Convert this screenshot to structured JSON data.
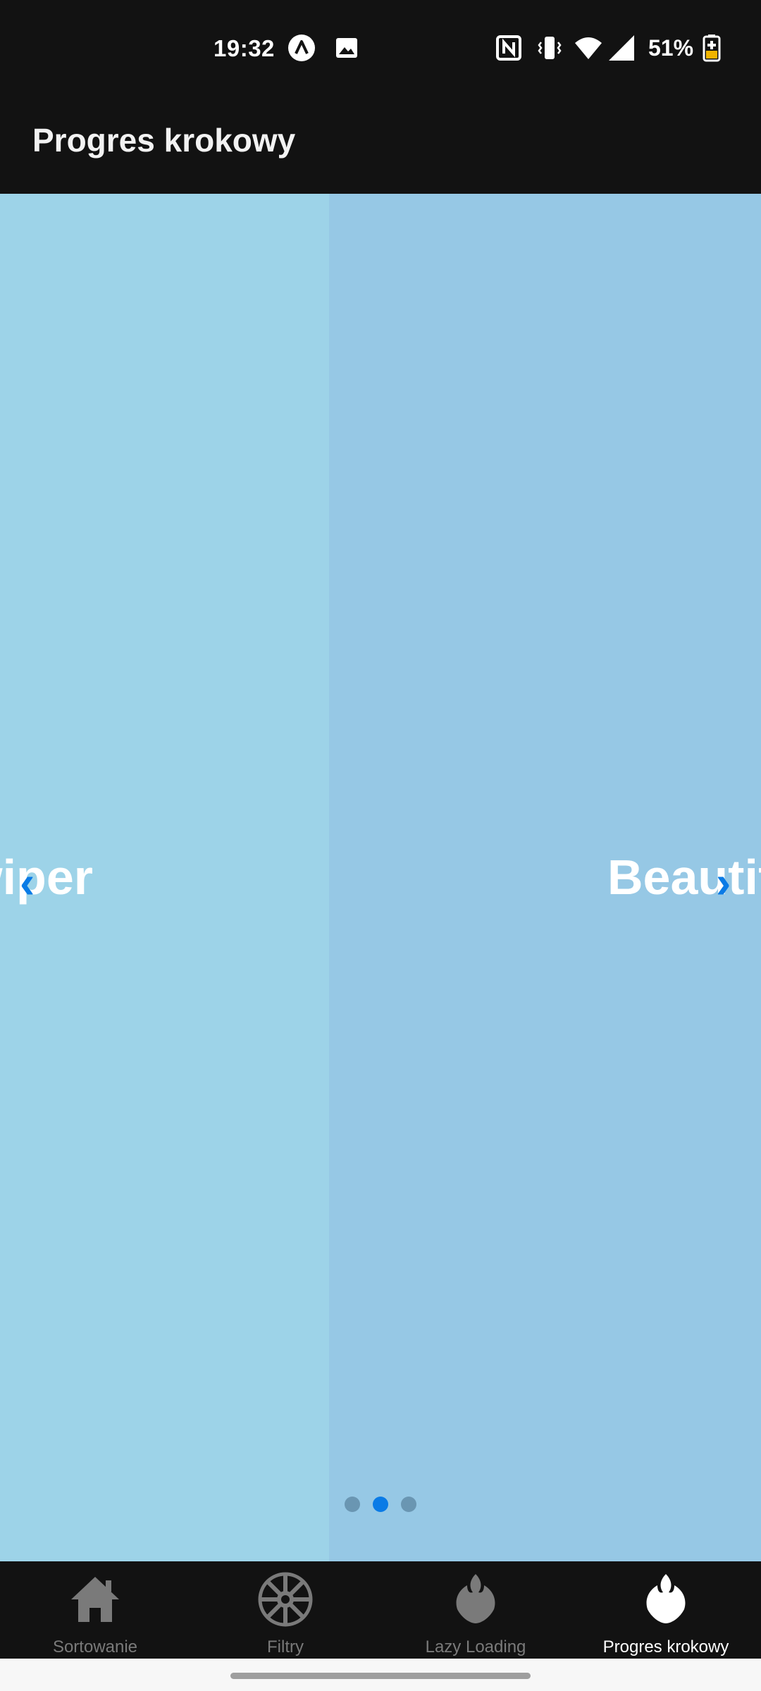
{
  "status_bar": {
    "time": "19:32",
    "battery_percent": "51%",
    "icons": [
      "expo-icon",
      "image-icon",
      "nfc-icon",
      "vibrate-icon",
      "wifi-icon",
      "signal-icon",
      "battery-charging-icon"
    ]
  },
  "header": {
    "title": "Progres krokowy"
  },
  "slider": {
    "prev_slide_text": "Swiper",
    "current_slide_text": "Beautiful",
    "prev_arrow": "‹",
    "next_arrow": "›",
    "page_count": 3,
    "active_page": 2,
    "colors": {
      "prev_slide_bg": "#9dd3e8",
      "current_slide_bg": "#96c8e5",
      "accent": "#0a7be6",
      "inactive_dot": "#6a96b2"
    }
  },
  "tabs": [
    {
      "label": "Sortowanie",
      "icon": "home-icon",
      "active": false
    },
    {
      "label": "Filtry",
      "icon": "galactic-empire-icon",
      "active": false
    },
    {
      "label": "Lazy Loading",
      "icon": "rebel-alliance-icon",
      "active": false
    },
    {
      "label": "Progres krokowy",
      "icon": "rebel-alliance-icon",
      "active": true
    }
  ]
}
